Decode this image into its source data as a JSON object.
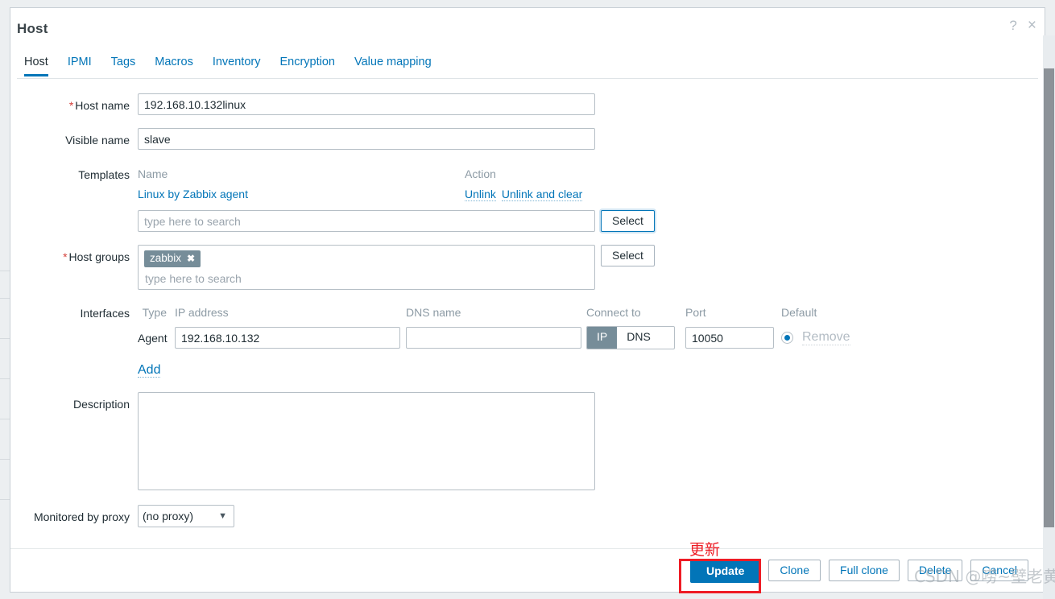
{
  "window": {
    "title": "Host",
    "help_icon": "?",
    "close_icon": "×"
  },
  "tabs": [
    {
      "label": "Host",
      "active": true
    },
    {
      "label": "IPMI",
      "active": false
    },
    {
      "label": "Tags",
      "active": false
    },
    {
      "label": "Macros",
      "active": false
    },
    {
      "label": "Inventory",
      "active": false
    },
    {
      "label": "Encryption",
      "active": false
    },
    {
      "label": "Value mapping",
      "active": false
    }
  ],
  "form": {
    "host_name": {
      "label": "Host name",
      "required": true,
      "value": "192.168.10.132linux"
    },
    "visible_name": {
      "label": "Visible name",
      "required": false,
      "value": "slave"
    },
    "templates": {
      "label": "Templates",
      "col_name": "Name",
      "col_action": "Action",
      "rows": [
        {
          "name": "Linux by Zabbix agent",
          "unlink": "Unlink",
          "unlink_and_clear": "Unlink and clear"
        }
      ],
      "search_placeholder": "type here to search",
      "select_label": "Select"
    },
    "host_groups": {
      "label": "Host groups",
      "required": true,
      "chips": [
        {
          "name": "zabbix",
          "remove_icon": "✖"
        }
      ],
      "search_placeholder": "type here to search",
      "select_label": "Select"
    },
    "interfaces": {
      "label": "Interfaces",
      "headers": {
        "type": "Type",
        "ip_address": "IP address",
        "dns_name": "DNS name",
        "connect_to": "Connect to",
        "port": "Port",
        "default": "Default"
      },
      "rows": [
        {
          "type": "Agent",
          "ip_address": "192.168.10.132",
          "dns_name": "",
          "connect_to_options": [
            "IP",
            "DNS"
          ],
          "connect_to_selected": "IP",
          "port": "10050",
          "default_selected": true,
          "remove_label": "Remove"
        }
      ],
      "add_label": "Add"
    },
    "description": {
      "label": "Description",
      "value": ""
    },
    "monitored_by_proxy": {
      "label": "Monitored by proxy",
      "selected": "(no proxy)",
      "options": [
        "(no proxy)"
      ]
    }
  },
  "footer_buttons": [
    {
      "label": "Update",
      "style": "primary"
    },
    {
      "label": "Clone",
      "style": "default"
    },
    {
      "label": "Full clone",
      "style": "default"
    },
    {
      "label": "Delete",
      "style": "default"
    },
    {
      "label": "Cancel",
      "style": "default"
    }
  ],
  "annotations": {
    "update_note": "更新",
    "watermark": "CSDN @唠~壁老黄"
  },
  "colors": {
    "accent": "#0275b8",
    "required": "#d43f3a",
    "annotation": "#ee1c25",
    "chip_bg": "#768d99"
  }
}
